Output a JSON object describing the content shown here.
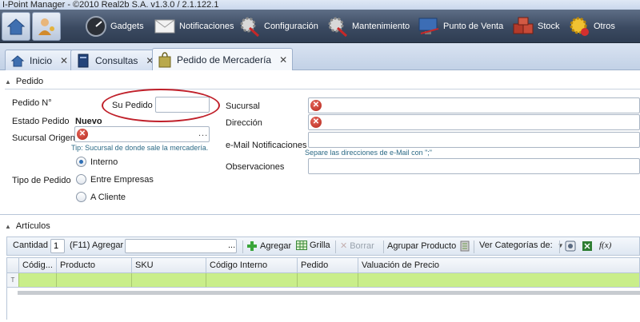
{
  "window": {
    "title": "I-Point Manager - ©2010 Real2b S.A. v1.3.0 / 2.1.122.1"
  },
  "toolbar": {
    "items": [
      {
        "label": "Gadgets",
        "icon": "gauge-icon"
      },
      {
        "label": "Notificaciones",
        "icon": "envelope-icon"
      },
      {
        "label": "Configuración",
        "icon": "gear-wrench-icon"
      },
      {
        "label": "Mantenimiento",
        "icon": "gear-wrench-icon"
      },
      {
        "label": "Punto de Venta",
        "icon": "monitor-icon"
      },
      {
        "label": "Stock",
        "icon": "boxes-icon"
      },
      {
        "label": "Otros",
        "icon": "gear-warning-icon"
      }
    ]
  },
  "tabs": [
    {
      "label": "Inicio",
      "icon": "home-icon",
      "close": "✕"
    },
    {
      "label": "Consultas",
      "icon": "document-icon",
      "close": "✕"
    },
    {
      "label": "Pedido de Mercadería",
      "icon": "bag-icon",
      "close": "✕",
      "active": true
    }
  ],
  "pedido": {
    "section_title": "Pedido",
    "pedido_no_label": "Pedido N°",
    "su_pedido_label": "Su Pedido",
    "su_pedido_value": "",
    "estado_label": "Estado Pedido",
    "estado_value": "Nuevo",
    "sucursal_origen_label": "Sucursal Origen",
    "sucursal_origen_tip": "Tip: Sucursal de donde sale la mercadería.",
    "tipo_label": "Tipo de Pedido",
    "tipo_options": [
      {
        "label": "Interno",
        "checked": true
      },
      {
        "label": "Entre Empresas",
        "checked": false
      },
      {
        "label": "A Cliente",
        "checked": false
      }
    ],
    "sucursal_label": "Sucursal",
    "direccion_label": "Dirección",
    "email_label": "e-Mail Notificaciones",
    "email_tip": "Separe las direcciones de e-Mail con \";\"",
    "observaciones_label": "Observaciones",
    "ellipsis": "..."
  },
  "articulos": {
    "section_title": "Artículos",
    "cantidad_label": "Cantidad",
    "cantidad_value": "1",
    "f11_label": "(F11)",
    "agregar_label": "Agregar",
    "agregar_button": "Agregar",
    "grilla_button": "Grilla",
    "borrar_button": "Borrar",
    "agrupar_button": "Agrupar Producto",
    "ver_categorias_label": "Ver Categorías de:",
    "fx_label": "f(x)",
    "columns": [
      "Códig...",
      "Producto",
      "SKU",
      "Código Interno",
      "Pedido",
      "Valuación de Precio"
    ]
  },
  "colors": {
    "toolbar_bg": "#3b4a61",
    "filter_row": "#c9ee8a",
    "annotation_circle": "#c0202a",
    "error_icon": "#b3261b"
  }
}
